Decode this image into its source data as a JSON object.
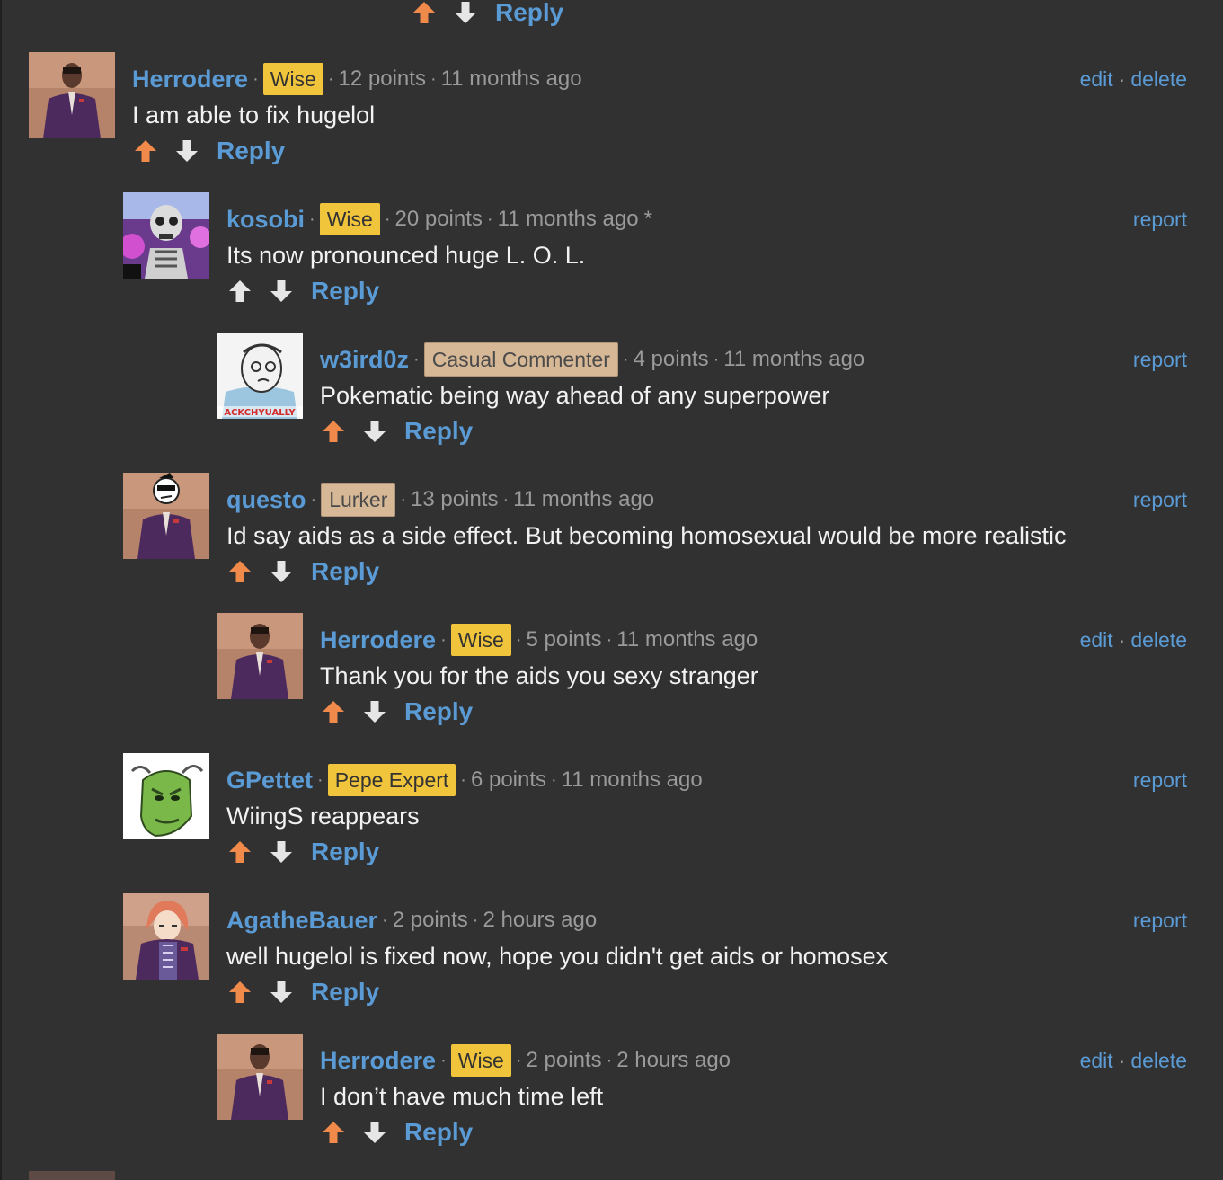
{
  "colors": {
    "background": "#313131",
    "link": "#5b9bd5",
    "upvote": "#f08a4b",
    "neutral_vote": "#e6e6e6",
    "badge_yellow": "#f0c43b",
    "badge_tan": "#d6b896"
  },
  "top_actions": {
    "reply_label": "Reply"
  },
  "comments": [
    {
      "username": "Herrodere",
      "badge": "Wise",
      "badge_style": "wise",
      "points": "12 points",
      "time": "11 months ago",
      "extra": "",
      "text": "I am able to fix hugelol",
      "mod": [
        "edit",
        "delete"
      ],
      "reply_label": "Reply",
      "upvoted": true,
      "avatar": "purple-suit-avatar"
    },
    {
      "username": "kosobi",
      "badge": "Wise",
      "badge_style": "wise",
      "points": "20 points",
      "time": "11 months ago",
      "extra": "*",
      "text": "Its now pronounced huge L. O. L.",
      "mod": [
        "report"
      ],
      "reply_label": "Reply",
      "upvoted": false,
      "avatar": "skeleton-avatar"
    },
    {
      "username": "w3ird0z",
      "badge": "Casual Commenter",
      "badge_style": "casual",
      "points": "4 points",
      "time": "11 months ago",
      "extra": "",
      "text": "Pokematic being way ahead of any superpower",
      "mod": [
        "report"
      ],
      "reply_label": "Reply",
      "upvoted": true,
      "avatar": "actually-guy-avatar",
      "avatar_caption": "ACKCHYUALLY"
    },
    {
      "username": "questo",
      "badge": "Lurker",
      "badge_style": "lurker",
      "points": "13 points",
      "time": "11 months ago",
      "extra": "",
      "text": "Id say aids as a side effect. But becoming homosexual would be more realistic",
      "mod": [
        "report"
      ],
      "reply_label": "Reply",
      "upvoted": true,
      "avatar": "suit-cartoon-head-avatar"
    },
    {
      "username": "Herrodere",
      "badge": "Wise",
      "badge_style": "wise",
      "points": "5 points",
      "time": "11 months ago",
      "extra": "",
      "text": "Thank you for the aids you sexy stranger",
      "mod": [
        "edit",
        "delete"
      ],
      "reply_label": "Reply",
      "upvoted": true,
      "avatar": "purple-suit-avatar"
    },
    {
      "username": "GPettet",
      "badge": "Pepe Expert",
      "badge_style": "pepe",
      "points": "6 points",
      "time": "11 months ago",
      "extra": "",
      "text": "WiingS reappears",
      "mod": [
        "report"
      ],
      "reply_label": "Reply",
      "upvoted": true,
      "avatar": "green-face-avatar"
    },
    {
      "username": "AgatheBauer",
      "badge": "",
      "badge_style": "",
      "points": "2 points",
      "time": "2 hours ago",
      "extra": "",
      "text": "well hugelol is fixed now, hope you didn't get aids or homosex",
      "mod": [
        "report"
      ],
      "reply_label": "Reply",
      "upvoted": true,
      "avatar": "anime-girl-suit-avatar"
    },
    {
      "username": "Herrodere",
      "badge": "Wise",
      "badge_style": "wise",
      "points": "2 points",
      "time": "2 hours ago",
      "extra": "",
      "text": "I don’t have much time left",
      "mod": [
        "edit",
        "delete"
      ],
      "reply_label": "Reply",
      "upvoted": true,
      "avatar": "purple-suit-avatar"
    }
  ]
}
